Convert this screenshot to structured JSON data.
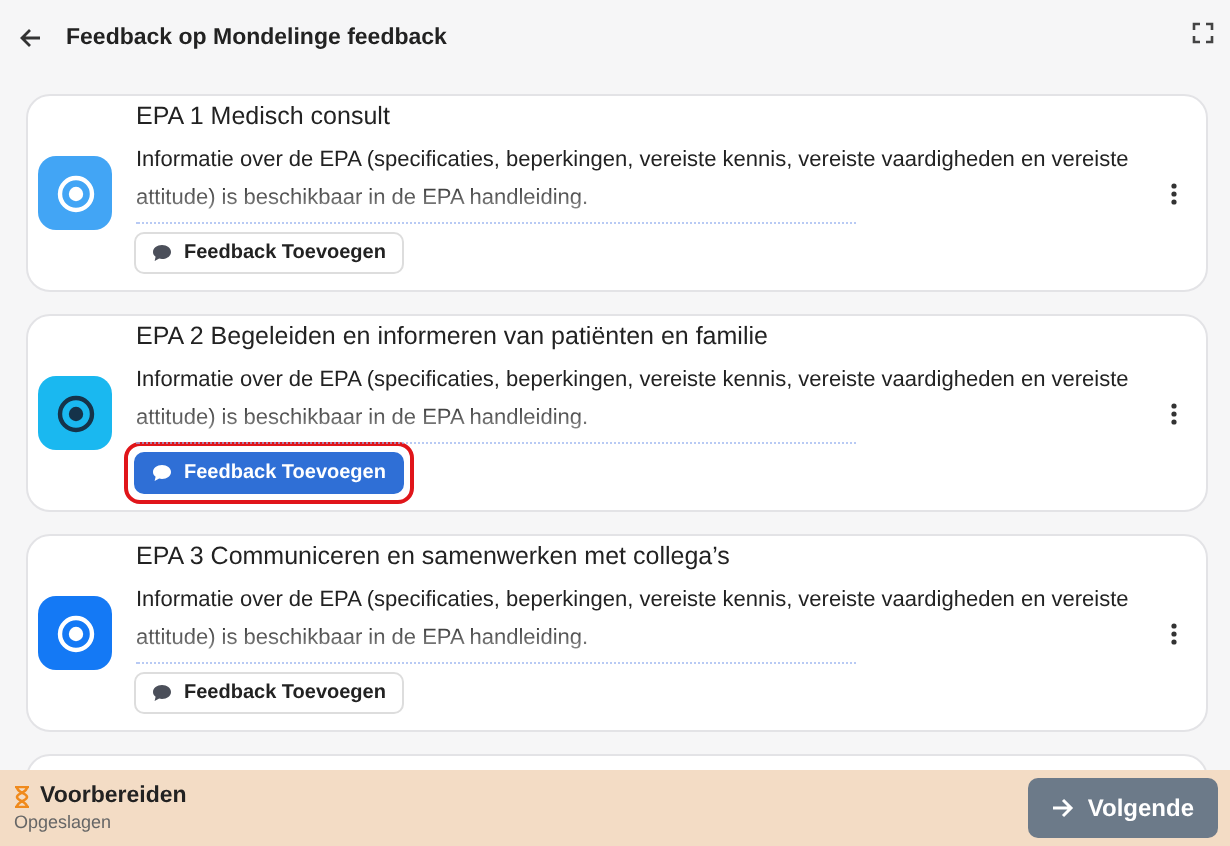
{
  "header": {
    "title": "Feedback op Mondelinge feedback"
  },
  "cards": [
    {
      "title": "EPA 1 Medisch consult",
      "description": "Informatie over de EPA (specificaties, beperkingen, vereiste kennis, vereiste vaardigheden en vereiste attitude) is beschikbaar in de EPA handleiding.",
      "color": "#42a5f5",
      "kind": "light",
      "button": {
        "label": "Feedback Toevoegen",
        "kind": "outline",
        "highlighted": false
      }
    },
    {
      "title": "EPA 2 Begeleiden en informeren van patiënten en familie",
      "description": "Informatie over de EPA (specificaties, beperkingen, vereiste kennis, vereiste vaardigheden en vereiste attitude) is beschikbaar in de EPA handleiding.",
      "color": "#1ab8f0",
      "kind": "dark",
      "button": {
        "label": "Feedback Toevoegen",
        "kind": "filled",
        "highlighted": true
      }
    },
    {
      "title": "EPA 3 Communiceren en samenwerken met collega’s",
      "description": "Informatie over de EPA (specificaties, beperkingen, vereiste kennis, vereiste vaardigheden en vereiste attitude) is beschikbaar in de EPA handleiding.",
      "color": "#1479f5",
      "kind": "light",
      "button": {
        "label": "Feedback Toevoegen",
        "kind": "outline",
        "highlighted": false
      }
    }
  ],
  "footer": {
    "status": "Voorbereiden",
    "substatus": "Opgeslagen",
    "next_button": "Volgende"
  }
}
